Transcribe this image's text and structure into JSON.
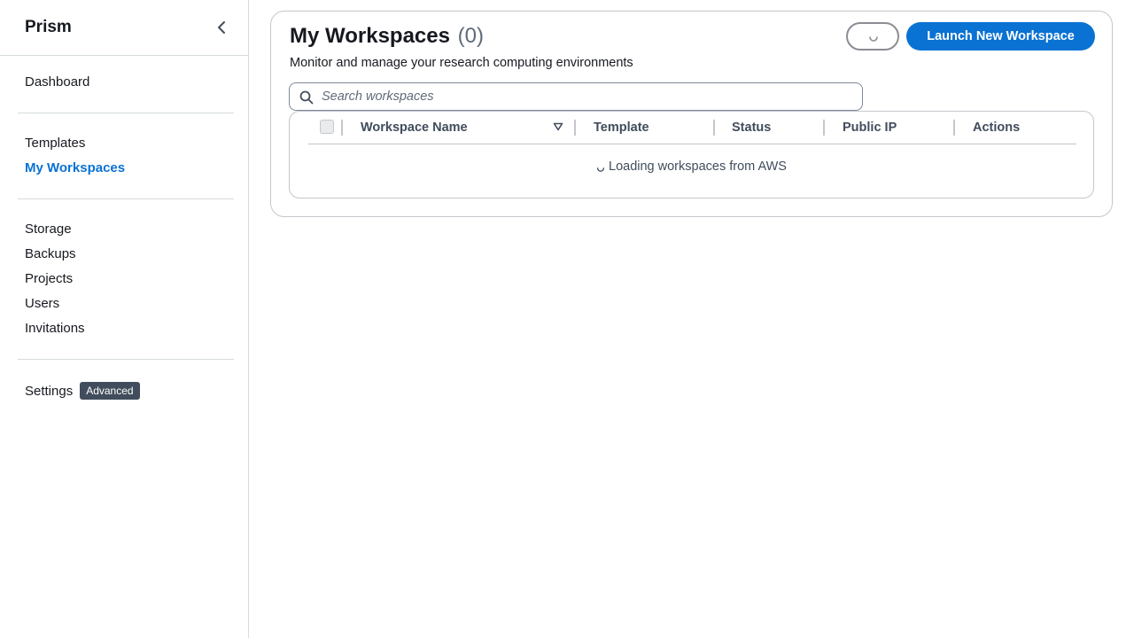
{
  "app": {
    "name": "Prism"
  },
  "sidebar": {
    "collapse_icon": "chevron-left-icon",
    "groups": [
      [
        {
          "label": "Dashboard",
          "active": false
        }
      ],
      [
        {
          "label": "Templates",
          "active": false
        },
        {
          "label": "My Workspaces",
          "active": true
        }
      ],
      [
        {
          "label": "Storage",
          "active": false
        },
        {
          "label": "Backups",
          "active": false
        },
        {
          "label": "Projects",
          "active": false
        },
        {
          "label": "Users",
          "active": false
        },
        {
          "label": "Invitations",
          "active": false
        }
      ],
      [
        {
          "label": "Settings",
          "active": false,
          "badge": "Advanced"
        }
      ]
    ]
  },
  "main": {
    "title": "My Workspaces",
    "count": "(0)",
    "description": "Monitor and manage your research computing environments",
    "refresh_icon": "spinner-icon",
    "launch_button": "Launch New Workspace",
    "search": {
      "placeholder": "Search workspaces",
      "value": ""
    },
    "table": {
      "columns": [
        "Workspace Name",
        "Template",
        "Status",
        "Public IP",
        "Actions"
      ],
      "sorted_column": "Workspace Name",
      "loading_text": "Loading workspaces from AWS"
    }
  },
  "colors": {
    "accent": "#0972d3",
    "badge_bg": "#414d5c",
    "border": "#c6c6cd"
  }
}
